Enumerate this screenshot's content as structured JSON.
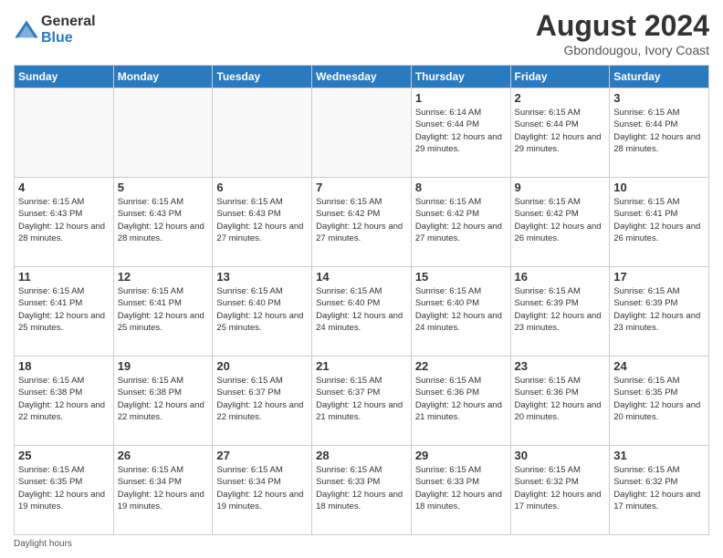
{
  "logo": {
    "general": "General",
    "blue": "Blue"
  },
  "title": "August 2024",
  "subtitle": "Gbondougou, Ivory Coast",
  "footer": "Daylight hours",
  "headers": [
    "Sunday",
    "Monday",
    "Tuesday",
    "Wednesday",
    "Thursday",
    "Friday",
    "Saturday"
  ],
  "weeks": [
    [
      {
        "day": "",
        "info": ""
      },
      {
        "day": "",
        "info": ""
      },
      {
        "day": "",
        "info": ""
      },
      {
        "day": "",
        "info": ""
      },
      {
        "day": "1",
        "info": "Sunrise: 6:14 AM\nSunset: 6:44 PM\nDaylight: 12 hours and 29 minutes."
      },
      {
        "day": "2",
        "info": "Sunrise: 6:15 AM\nSunset: 6:44 PM\nDaylight: 12 hours and 29 minutes."
      },
      {
        "day": "3",
        "info": "Sunrise: 6:15 AM\nSunset: 6:44 PM\nDaylight: 12 hours and 28 minutes."
      }
    ],
    [
      {
        "day": "4",
        "info": "Sunrise: 6:15 AM\nSunset: 6:43 PM\nDaylight: 12 hours and 28 minutes."
      },
      {
        "day": "5",
        "info": "Sunrise: 6:15 AM\nSunset: 6:43 PM\nDaylight: 12 hours and 28 minutes."
      },
      {
        "day": "6",
        "info": "Sunrise: 6:15 AM\nSunset: 6:43 PM\nDaylight: 12 hours and 27 minutes."
      },
      {
        "day": "7",
        "info": "Sunrise: 6:15 AM\nSunset: 6:42 PM\nDaylight: 12 hours and 27 minutes."
      },
      {
        "day": "8",
        "info": "Sunrise: 6:15 AM\nSunset: 6:42 PM\nDaylight: 12 hours and 27 minutes."
      },
      {
        "day": "9",
        "info": "Sunrise: 6:15 AM\nSunset: 6:42 PM\nDaylight: 12 hours and 26 minutes."
      },
      {
        "day": "10",
        "info": "Sunrise: 6:15 AM\nSunset: 6:41 PM\nDaylight: 12 hours and 26 minutes."
      }
    ],
    [
      {
        "day": "11",
        "info": "Sunrise: 6:15 AM\nSunset: 6:41 PM\nDaylight: 12 hours and 25 minutes."
      },
      {
        "day": "12",
        "info": "Sunrise: 6:15 AM\nSunset: 6:41 PM\nDaylight: 12 hours and 25 minutes."
      },
      {
        "day": "13",
        "info": "Sunrise: 6:15 AM\nSunset: 6:40 PM\nDaylight: 12 hours and 25 minutes."
      },
      {
        "day": "14",
        "info": "Sunrise: 6:15 AM\nSunset: 6:40 PM\nDaylight: 12 hours and 24 minutes."
      },
      {
        "day": "15",
        "info": "Sunrise: 6:15 AM\nSunset: 6:40 PM\nDaylight: 12 hours and 24 minutes."
      },
      {
        "day": "16",
        "info": "Sunrise: 6:15 AM\nSunset: 6:39 PM\nDaylight: 12 hours and 23 minutes."
      },
      {
        "day": "17",
        "info": "Sunrise: 6:15 AM\nSunset: 6:39 PM\nDaylight: 12 hours and 23 minutes."
      }
    ],
    [
      {
        "day": "18",
        "info": "Sunrise: 6:15 AM\nSunset: 6:38 PM\nDaylight: 12 hours and 22 minutes."
      },
      {
        "day": "19",
        "info": "Sunrise: 6:15 AM\nSunset: 6:38 PM\nDaylight: 12 hours and 22 minutes."
      },
      {
        "day": "20",
        "info": "Sunrise: 6:15 AM\nSunset: 6:37 PM\nDaylight: 12 hours and 22 minutes."
      },
      {
        "day": "21",
        "info": "Sunrise: 6:15 AM\nSunset: 6:37 PM\nDaylight: 12 hours and 21 minutes."
      },
      {
        "day": "22",
        "info": "Sunrise: 6:15 AM\nSunset: 6:36 PM\nDaylight: 12 hours and 21 minutes."
      },
      {
        "day": "23",
        "info": "Sunrise: 6:15 AM\nSunset: 6:36 PM\nDaylight: 12 hours and 20 minutes."
      },
      {
        "day": "24",
        "info": "Sunrise: 6:15 AM\nSunset: 6:35 PM\nDaylight: 12 hours and 20 minutes."
      }
    ],
    [
      {
        "day": "25",
        "info": "Sunrise: 6:15 AM\nSunset: 6:35 PM\nDaylight: 12 hours and 19 minutes."
      },
      {
        "day": "26",
        "info": "Sunrise: 6:15 AM\nSunset: 6:34 PM\nDaylight: 12 hours and 19 minutes."
      },
      {
        "day": "27",
        "info": "Sunrise: 6:15 AM\nSunset: 6:34 PM\nDaylight: 12 hours and 19 minutes."
      },
      {
        "day": "28",
        "info": "Sunrise: 6:15 AM\nSunset: 6:33 PM\nDaylight: 12 hours and 18 minutes."
      },
      {
        "day": "29",
        "info": "Sunrise: 6:15 AM\nSunset: 6:33 PM\nDaylight: 12 hours and 18 minutes."
      },
      {
        "day": "30",
        "info": "Sunrise: 6:15 AM\nSunset: 6:32 PM\nDaylight: 12 hours and 17 minutes."
      },
      {
        "day": "31",
        "info": "Sunrise: 6:15 AM\nSunset: 6:32 PM\nDaylight: 12 hours and 17 minutes."
      }
    ]
  ]
}
